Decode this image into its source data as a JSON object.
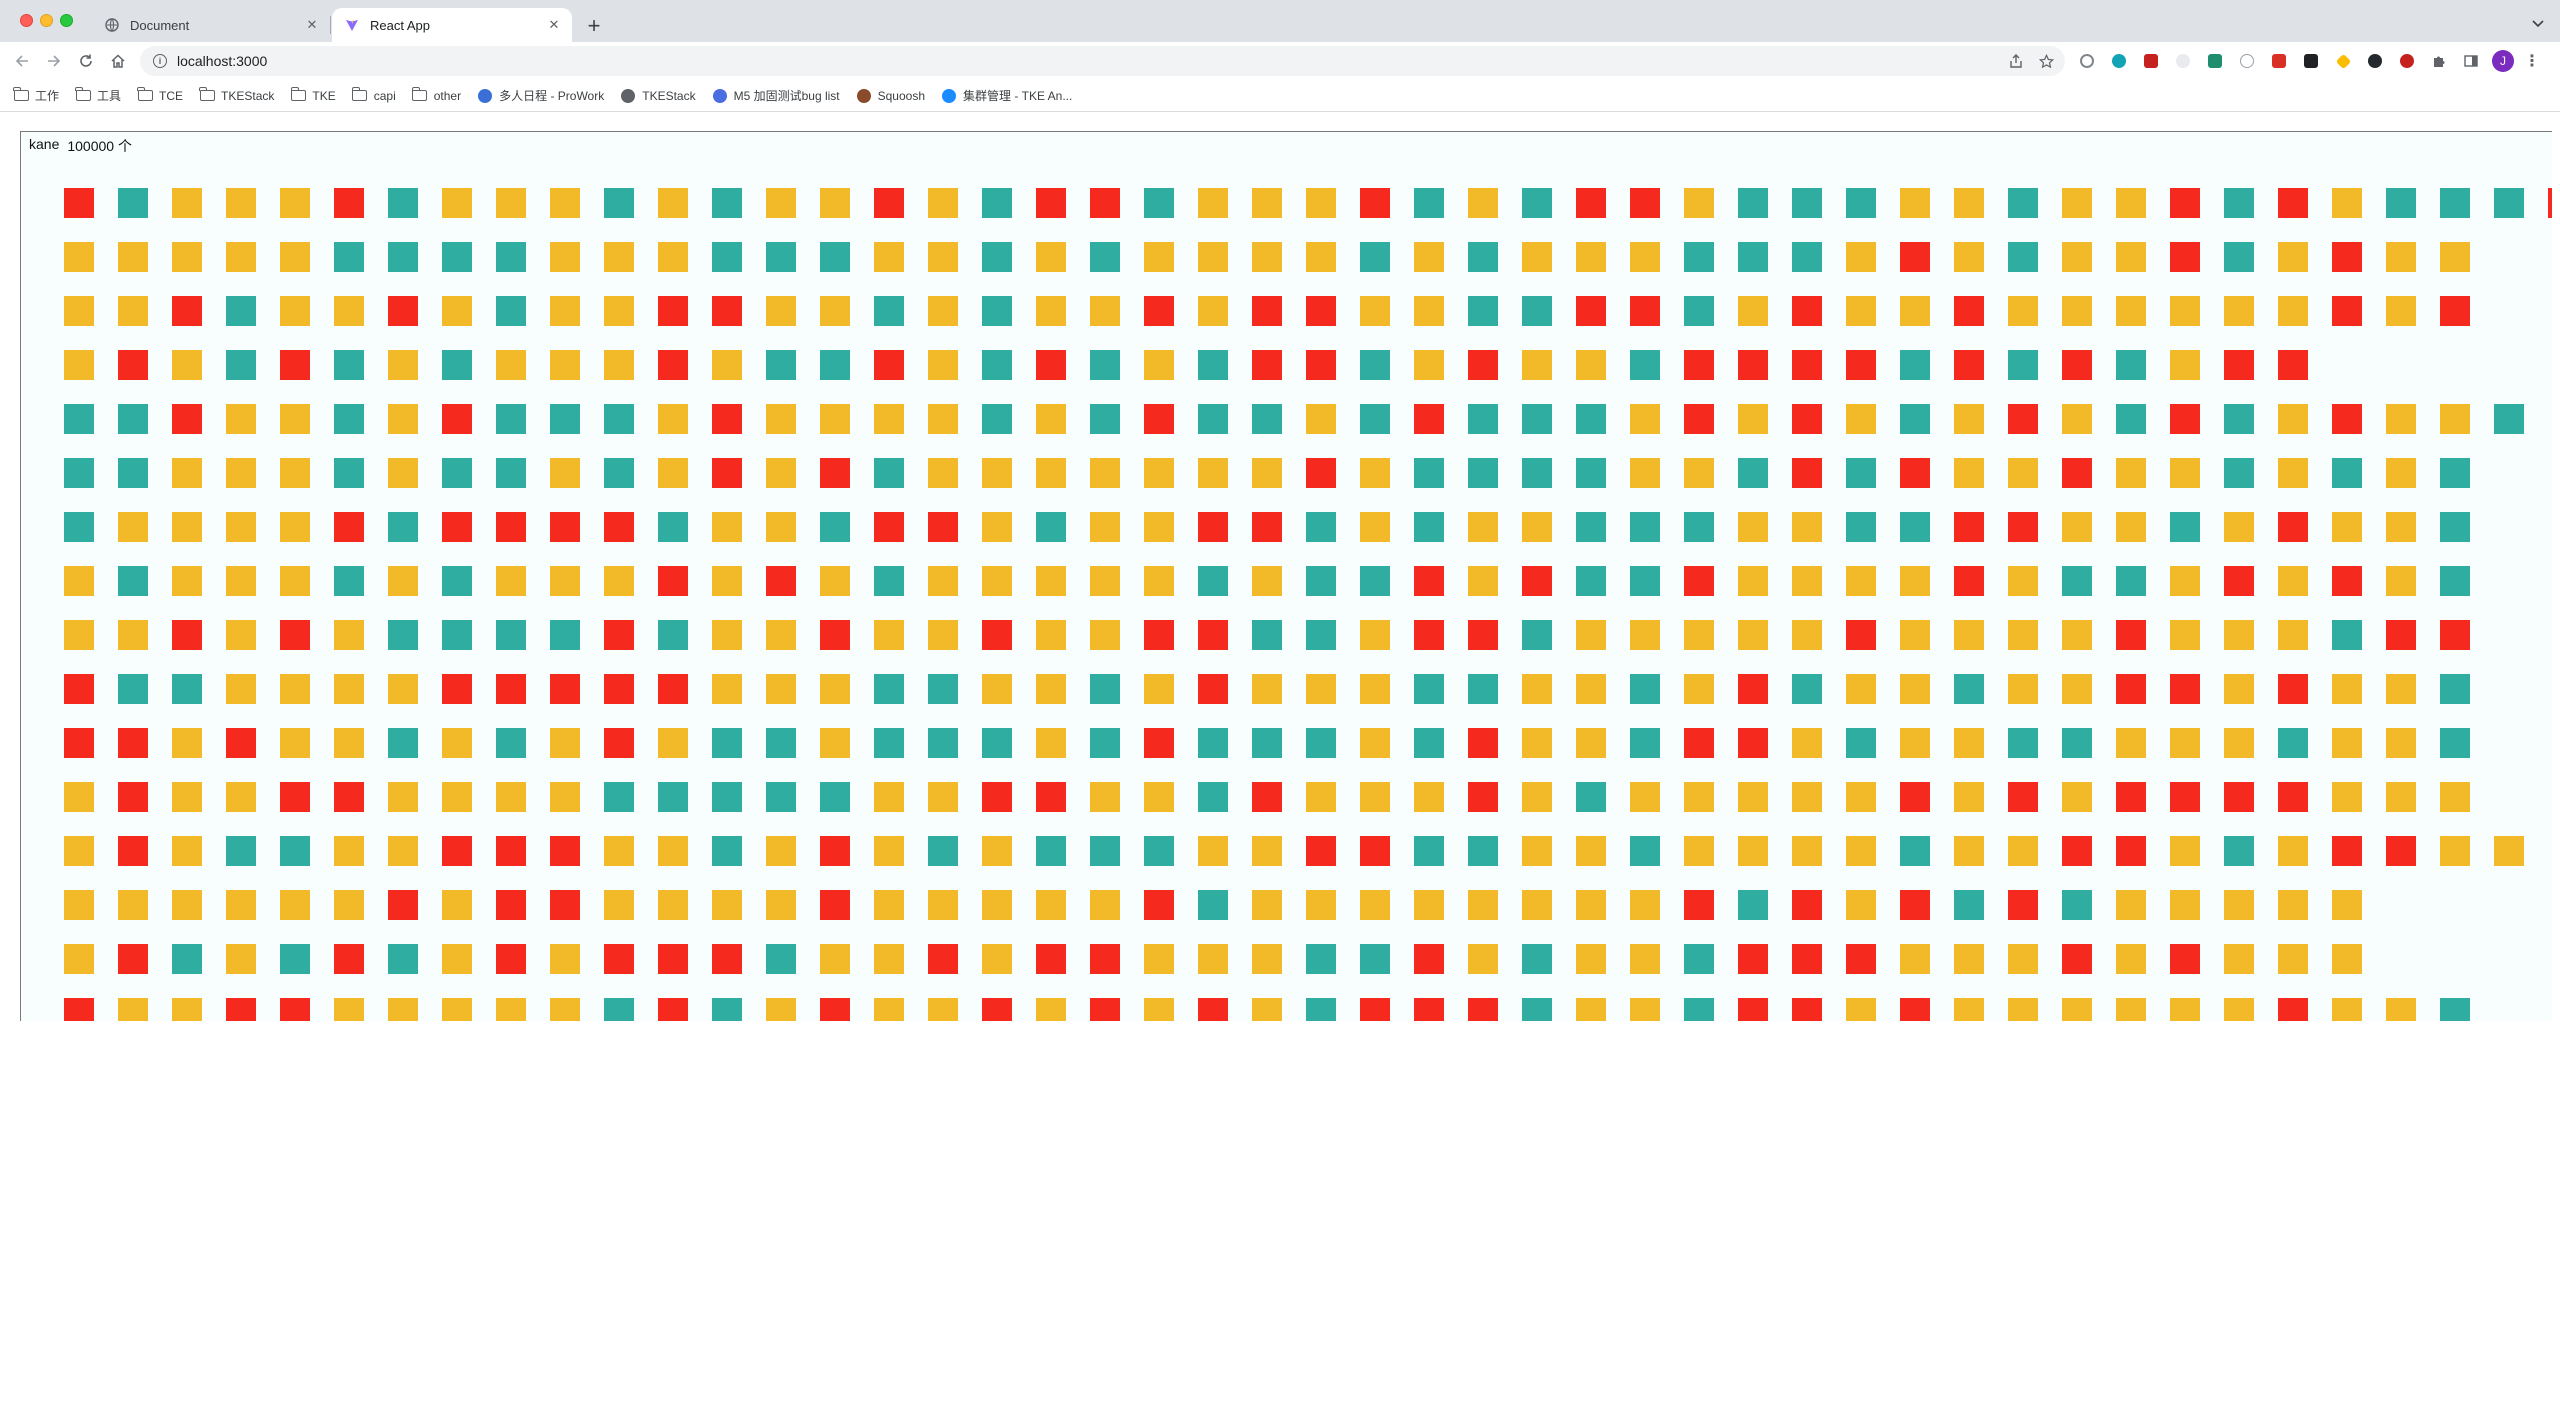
{
  "browser": {
    "tabs": [
      {
        "title": "Document",
        "active": false,
        "favicon": "globe-icon"
      },
      {
        "title": "React App",
        "active": true,
        "favicon": "vite-icon"
      }
    ],
    "address": "localhost:3000"
  },
  "bookmarks": [
    {
      "label": "工作",
      "icon": "folder-icon"
    },
    {
      "label": "工具",
      "icon": "folder-icon"
    },
    {
      "label": "TCE",
      "icon": "folder-icon"
    },
    {
      "label": "TKEStack",
      "icon": "folder-icon"
    },
    {
      "label": "TKE",
      "icon": "folder-icon"
    },
    {
      "label": "capi",
      "icon": "folder-icon"
    },
    {
      "label": "other",
      "icon": "folder-icon"
    },
    {
      "label": "多人日程 - ProWork",
      "icon": "prowork-icon"
    },
    {
      "label": "TKEStack",
      "icon": "globe-icon"
    },
    {
      "label": "M5 加固测试bug list",
      "icon": "bug-list-icon"
    },
    {
      "label": "Squoosh",
      "icon": "squoosh-icon"
    },
    {
      "label": "集群管理 - TKE An...",
      "icon": "tke-icon"
    }
  ],
  "app": {
    "user": "kane",
    "count_label": "100000 个"
  },
  "colors": {
    "red": "#f5291e",
    "teal": "#2fada0",
    "yellow": "#f2b929"
  },
  "grid_rows": [
    "RTYYYRTYYYTYTYYRYTRRTYYYRTYTRRYTTTYYTYYRTRYTTTR",
    "YYYYYTTTTYYYTTTYYTYTYYYYTYTYYYTTTYRYTYYRTYRYY",
    "YYRTYYRYTYYRRYYTYTYYRYRRYYTTRRTYRYYRYYYYYYRYR",
    "YRYTRTYTYYYRYTTRYTRTYTRRTYRYYTRRRRTRTRTYRR",
    "TTRYYTYRTTTYRYYYYTYTRTTYTRTTTYRYRYTYRYTRTYRYYT",
    "TTYYYTYTTYTYRYRTYYYYYYYRYTTTTYYTRTRYYRYYTYTYT",
    "TYYYYRTRRRRTYYTRRYTYYRRTYTYYTTTYYTTRRYYTYRYYT",
    "YTYYYTYTYYYRYRYTYYYYYTYTTRYRTTRYYYYRYTTYRYRYT",
    "YYRYRYTTTTRTYYRYYRYYRRTTYRRTYYYYYRYYYYRYYYTRR",
    "RTTYYYYRRRRRYYYTTYYTYRYYYTTYYTYRTYYTYYRRYRYYT",
    "RRYRYYTYTYRYTTYTTTYTRTTTYTRYYTRRYTYYTTYYYTYYT",
    "YRYYRRYYYYTTTTTYYRRYYTRYYYRYTYYYYYRYRYRRRRYYY",
    "YRYTTYYRRRYYTYRYTYTTTYYRRTTYYTYYYYTYYRRYTYRRYY",
    "YYYYYYRYRRYYYYRYYYYYRTYYYYYYYYRTRYRTRTYYYYY",
    "YRTYTRTYRYRRRTYYRYRRYYYTTRYTYYTRRRYYYRYRYYY",
    "RYYRRYYYYYTRTYRYYRYRYRYTRRRTYYTRRYRYYYYYYRYYT"
  ]
}
